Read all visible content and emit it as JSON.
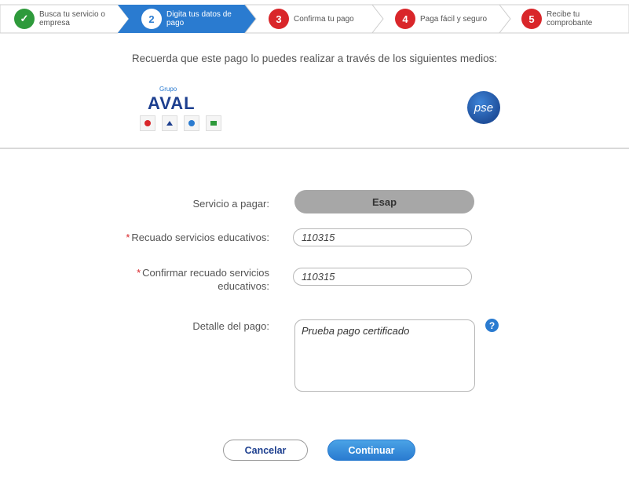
{
  "steps": [
    {
      "num": "✓",
      "label": "Busca tu servicio o empresa",
      "state": "done"
    },
    {
      "num": "2",
      "label": "Digita tus datos de pago",
      "state": "active"
    },
    {
      "num": "3",
      "label": "Confirma tu pago",
      "state": "todo"
    },
    {
      "num": "4",
      "label": "Paga fácil y seguro",
      "state": "todo"
    },
    {
      "num": "5",
      "label": "Recibe tu comprobante",
      "state": "todo"
    }
  ],
  "intro": "Recuerda que este pago lo puedes realizar a través de los siguientes medios:",
  "aval": {
    "grupo": "Grupo",
    "word": "AVAL"
  },
  "pse": {
    "label": "pse"
  },
  "form": {
    "service_label": "Servicio a pagar:",
    "service_value": "Esap",
    "recaudo_label": "Recuado servicios educativos:",
    "recaudo_value": "110315",
    "confirm_label_1": "Confirmar recuado servicios",
    "confirm_label_2": "educativos:",
    "confirm_value": "110315",
    "detail_label": "Detalle del pago:",
    "detail_value": "Prueba pago certificado",
    "help_icon": "?",
    "required_mark": "*"
  },
  "buttons": {
    "cancel": "Cancelar",
    "continue": "Continuar"
  },
  "colors": {
    "accent": "#2a7bd0",
    "done": "#2e9a3b",
    "pending": "#d9262a"
  }
}
